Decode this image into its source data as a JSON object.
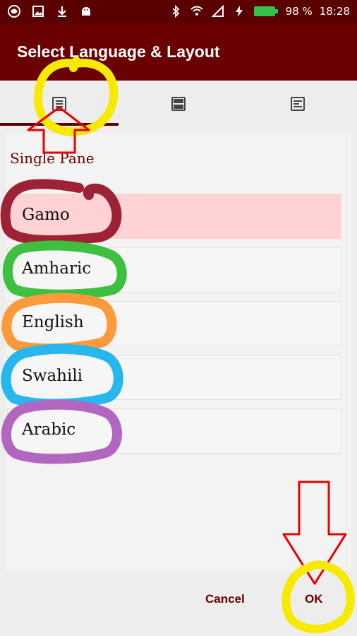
{
  "status_bar": {
    "battery": "98 %",
    "time": "18:28",
    "icons_left": [
      "app-icon",
      "image-icon",
      "download-icon",
      "android-icon"
    ],
    "icons_right": [
      "bluetooth-icon",
      "wifi-icon",
      "signal-icon",
      "charging-icon",
      "battery-icon"
    ]
  },
  "app_bar": {
    "title": "Select Language & Layout"
  },
  "tabs": [
    {
      "icon": "single-pane-icon",
      "selected": true
    },
    {
      "icon": "double-pane-icon",
      "selected": false
    },
    {
      "icon": "list-pane-icon",
      "selected": false
    }
  ],
  "pane": {
    "label": "Single  Pane",
    "languages": [
      {
        "label": "Gamo",
        "selected": true
      },
      {
        "label": "Amharic",
        "selected": false
      },
      {
        "label": "English",
        "selected": false
      },
      {
        "label": "Swahili",
        "selected": false
      },
      {
        "label": "Arabic",
        "selected": false
      }
    ]
  },
  "footer": {
    "cancel_label": "Cancel",
    "ok_label": "OK"
  },
  "colors": {
    "status_bar": "#5a0000",
    "app_bar": "#6b0000",
    "accent_text": "#6b0000",
    "selected_item": "#ffd2d6",
    "annotation_yellow": "#f7ea00",
    "annotation_red": "#e60000",
    "circle_gamo": "#9e2236",
    "circle_amharic": "#3fbf3f",
    "circle_english": "#ff9a3c",
    "circle_swahili": "#27b6ee",
    "circle_arabic": "#b266c0"
  }
}
